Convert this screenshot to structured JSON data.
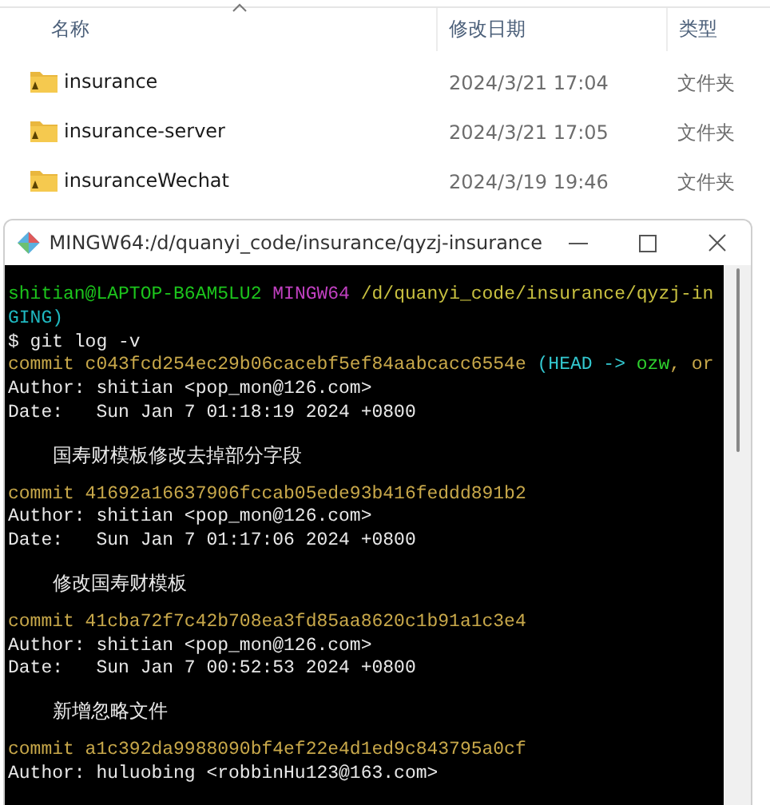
{
  "explorer": {
    "columns": [
      {
        "label": "名称",
        "sorted": true
      },
      {
        "label": "修改日期",
        "sorted": false
      },
      {
        "label": "类型",
        "sorted": false
      }
    ],
    "rows": [
      {
        "name": "insurance",
        "modified": "2024/3/21 17:04",
        "type": "文件夹"
      },
      {
        "name": "insurance-server",
        "modified": "2024/3/21 17:05",
        "type": "文件夹"
      },
      {
        "name": "insuranceWechat",
        "modified": "2024/3/19 19:46",
        "type": "文件夹"
      }
    ]
  },
  "terminal": {
    "title": "MINGW64:/d/quanyi_code/insurance/qyzj-insurance",
    "lines": [
      {
        "kind": "text",
        "segments": [
          {
            "text": "shitian@LAPTOP-B6AM5LU2 ",
            "color": "#1cc41c"
          },
          {
            "text": "MINGW64 ",
            "color": "#c040c0"
          },
          {
            "text": "/d/quanyi_code/insurance/qyzj-in",
            "color": "#c8c040"
          }
        ]
      },
      {
        "kind": "text",
        "segments": [
          {
            "text": "GING)",
            "color": "#1fb8c0"
          }
        ]
      },
      {
        "kind": "text",
        "segments": [
          {
            "text": "$ git log -v",
            "color": "#e8e8e8"
          }
        ]
      },
      {
        "kind": "text",
        "segments": [
          {
            "text": "commit c043fcd254ec29b06cacebf5ef84aabcacc6554e ",
            "color": "#c8a84a"
          },
          {
            "text": "(HEAD -> ",
            "color": "#33c8d0"
          },
          {
            "text": "ozw",
            "color": "#2ed02e"
          },
          {
            "text": ", or",
            "color": "#c8a84a"
          }
        ]
      },
      {
        "kind": "text",
        "segments": [
          {
            "text": "Author: shitian <pop_mon@126.com>",
            "color": "#e8e8e8"
          }
        ]
      },
      {
        "kind": "text",
        "segments": [
          {
            "text": "Date:   Sun Jan 7 01:18:19 2024 +0800",
            "color": "#e8e8e8"
          }
        ]
      },
      {
        "kind": "message",
        "segments": [
          {
            "text": "国寿财模板修改去掉部分字段",
            "color": "#e8e8e8"
          }
        ]
      },
      {
        "kind": "text",
        "segments": [
          {
            "text": "commit 41692a16637906fccab05ede93b416feddd891b2",
            "color": "#c8a84a"
          }
        ]
      },
      {
        "kind": "text",
        "segments": [
          {
            "text": "Author: shitian <pop_mon@126.com>",
            "color": "#e8e8e8"
          }
        ]
      },
      {
        "kind": "text",
        "segments": [
          {
            "text": "Date:   Sun Jan 7 01:17:06 2024 +0800",
            "color": "#e8e8e8"
          }
        ]
      },
      {
        "kind": "message",
        "segments": [
          {
            "text": "修改国寿财模板",
            "color": "#e8e8e8"
          }
        ]
      },
      {
        "kind": "text",
        "segments": [
          {
            "text": "commit 41cba72f7c42b708ea3fd85aa8620c1b91a1c3e4",
            "color": "#c8a84a"
          }
        ]
      },
      {
        "kind": "text",
        "segments": [
          {
            "text": "Author: shitian <pop_mon@126.com>",
            "color": "#e8e8e8"
          }
        ]
      },
      {
        "kind": "text",
        "segments": [
          {
            "text": "Date:   Sun Jan 7 00:52:53 2024 +0800",
            "color": "#e8e8e8"
          }
        ]
      },
      {
        "kind": "message",
        "segments": [
          {
            "text": "新增忽略文件",
            "color": "#e8e8e8"
          }
        ]
      },
      {
        "kind": "text",
        "segments": [
          {
            "text": "commit a1c392da9988090bf4ef22e4d1ed9c843795a0cf",
            "color": "#c8a84a"
          }
        ]
      },
      {
        "kind": "text",
        "segments": [
          {
            "text": "Author: huluobing <robbinHu123@163.com>",
            "color": "#e8e8e8"
          }
        ]
      }
    ]
  }
}
